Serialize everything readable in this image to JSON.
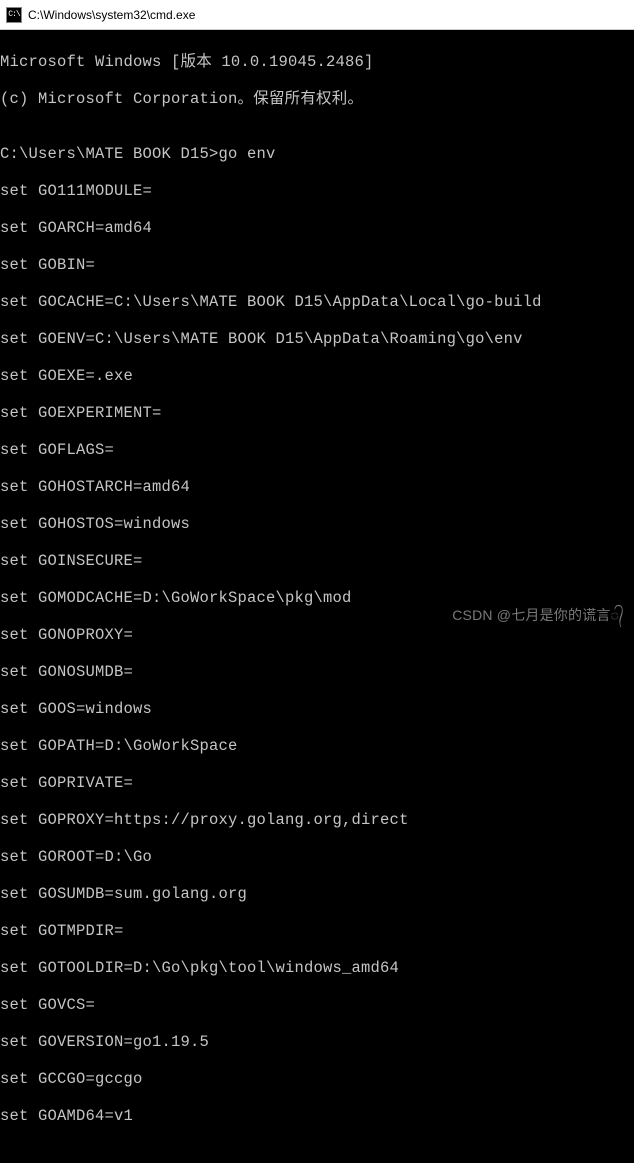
{
  "window": {
    "icon_label": "C:\\",
    "title": "C:\\Windows\\system32\\cmd.exe"
  },
  "terminal": {
    "banner_line1": "Microsoft Windows [版本 10.0.19045.2486]",
    "banner_line2": "(c) Microsoft Corporation。保留所有权利。",
    "blank": "",
    "prompt_line": "C:\\Users\\MATE BOOK D15>go env",
    "env_lines": [
      "set GO111MODULE=",
      "set GOARCH=amd64",
      "set GOBIN=",
      "set GOCACHE=C:\\Users\\MATE BOOK D15\\AppData\\Local\\go-build",
      "set GOENV=C:\\Users\\MATE BOOK D15\\AppData\\Roaming\\go\\env",
      "set GOEXE=.exe",
      "set GOEXPERIMENT=",
      "set GOFLAGS=",
      "set GOHOSTARCH=amd64",
      "set GOHOSTOS=windows",
      "set GOINSECURE=",
      "set GOMODCACHE=D:\\GoWorkSpace\\pkg\\mod",
      "set GONOPROXY=",
      "set GONOSUMDB=",
      "set GOOS=windows",
      "set GOPATH=D:\\GoWorkSpace",
      "set GOPRIVATE=",
      "set GOPROXY=https://proxy.golang.org,direct",
      "set GOROOT=D:\\Go",
      "set GOSUMDB=sum.golang.org",
      "set GOTMPDIR=",
      "set GOTOOLDIR=D:\\Go\\pkg\\tool\\windows_amd64",
      "set GOVCS=",
      "set GOVERSION=go1.19.5",
      "set GCCGO=gccgo",
      "set GOAMD64=v1"
    ]
  },
  "watermark": "CSDN @七月是你的谎言᭄"
}
